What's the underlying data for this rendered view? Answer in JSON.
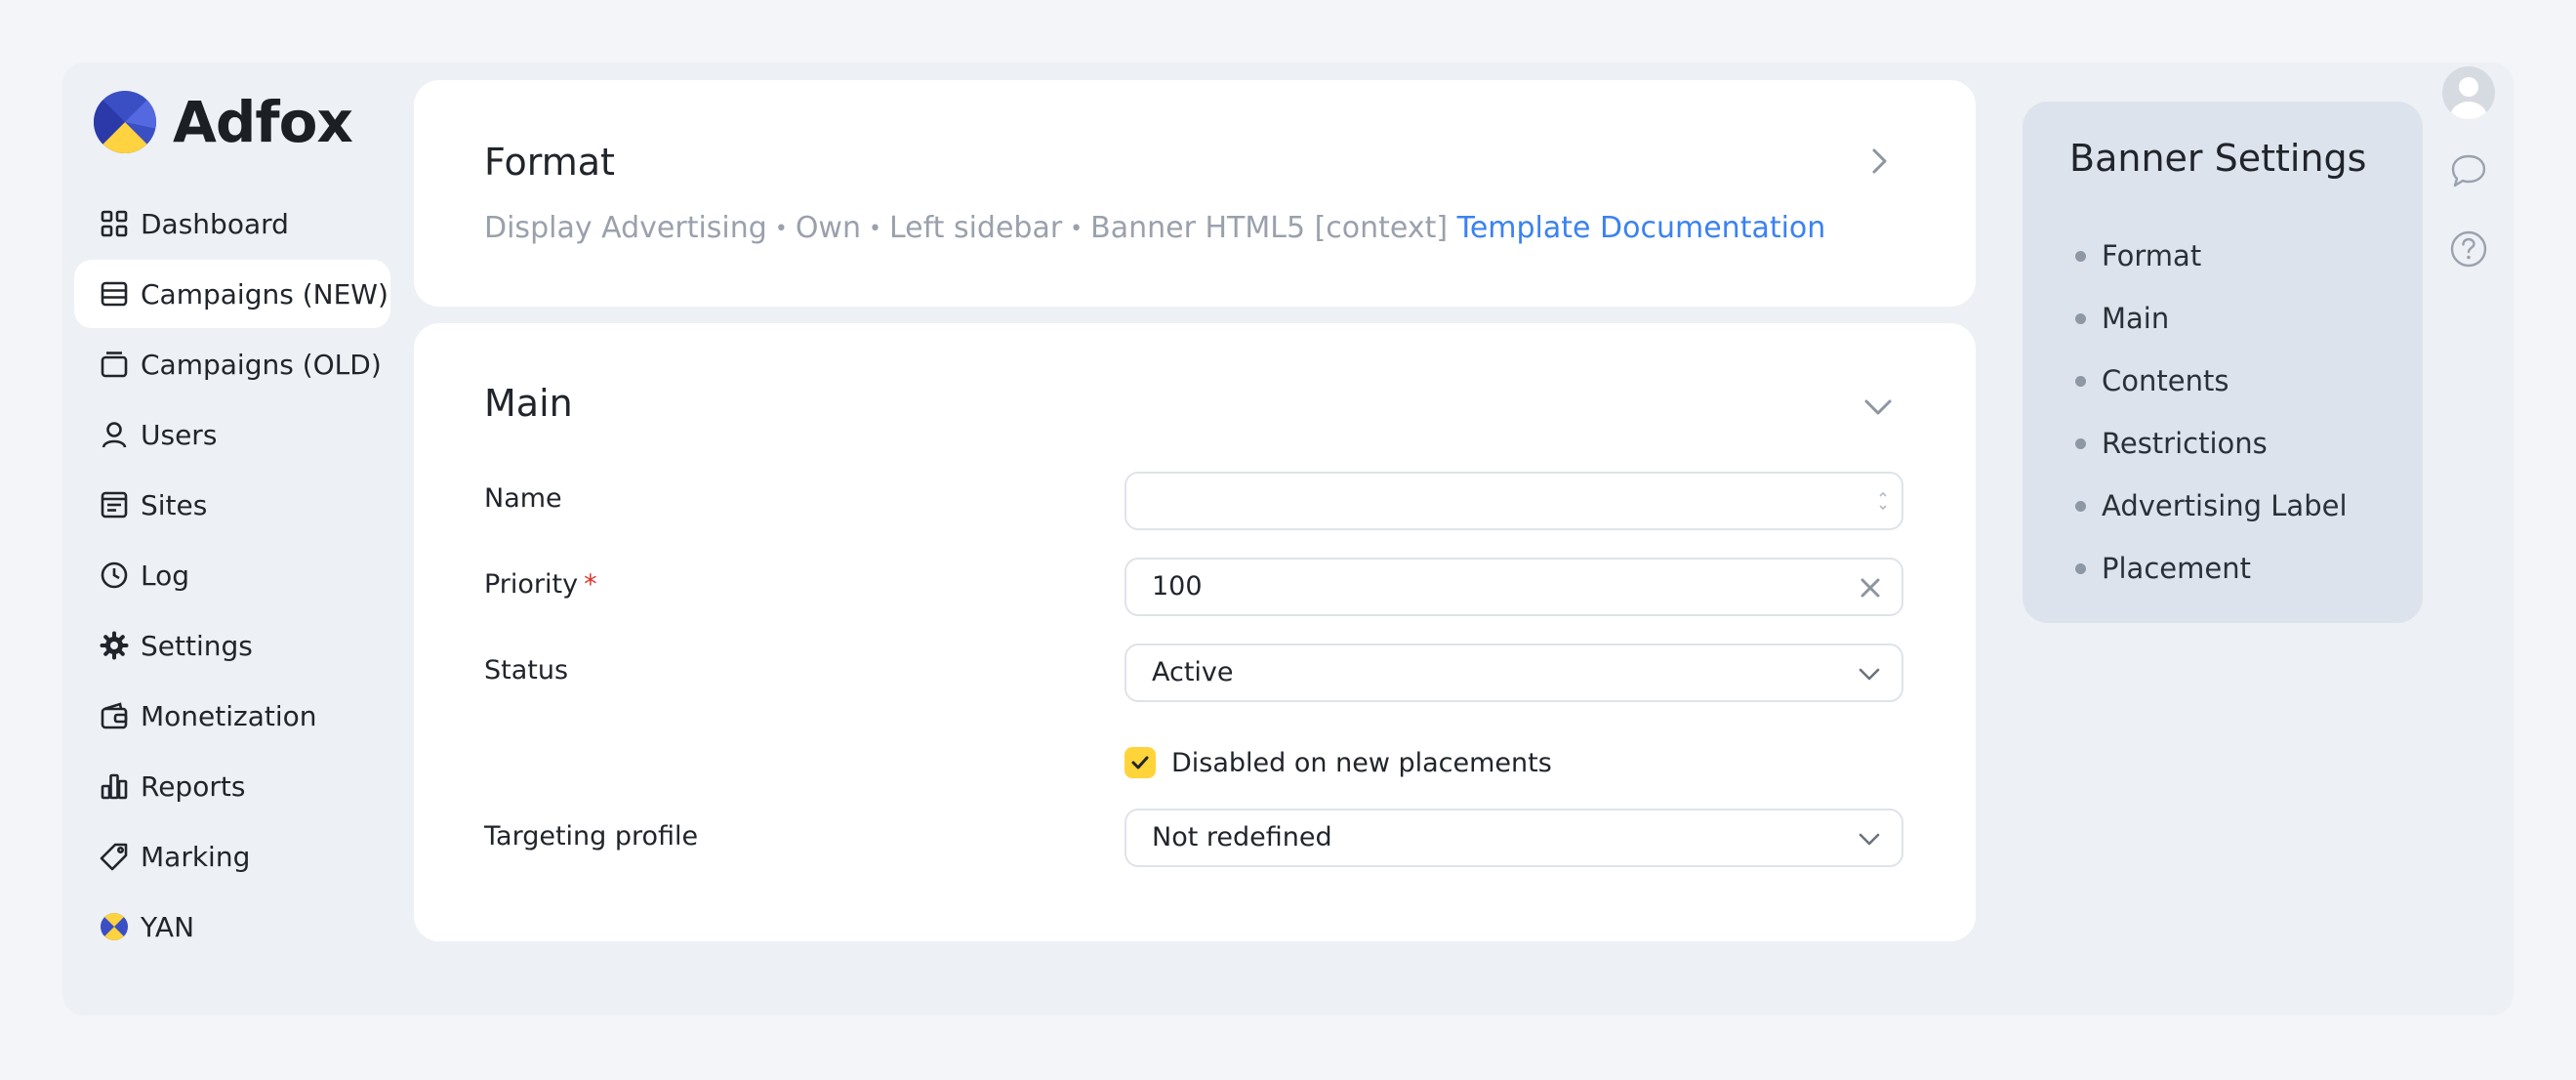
{
  "app": {
    "name": "Adfox"
  },
  "sidebar": {
    "items": [
      {
        "label": "Dashboard",
        "icon": "dashboard-icon",
        "active": false
      },
      {
        "label": "Campaigns (NEW)",
        "icon": "campaigns-icon",
        "active": true
      },
      {
        "label": "Campaigns (OLD)",
        "icon": "campaigns-old-icon",
        "active": false
      },
      {
        "label": "Users",
        "icon": "user-icon",
        "active": false
      },
      {
        "label": "Sites",
        "icon": "sites-icon",
        "active": false
      },
      {
        "label": "Log",
        "icon": "clock-icon",
        "active": false
      },
      {
        "label": "Settings",
        "icon": "gear-icon",
        "active": false
      },
      {
        "label": "Monetization",
        "icon": "wallet-icon",
        "active": false
      },
      {
        "label": "Reports",
        "icon": "bar-chart-icon",
        "active": false
      },
      {
        "label": "Marking",
        "icon": "tag-icon",
        "active": false
      },
      {
        "label": "YAN",
        "icon": "yan-logo-icon",
        "active": false
      }
    ]
  },
  "format_card": {
    "title": "Format",
    "breadcrumb": [
      "Display Advertising",
      "Own",
      "Left sidebar",
      "Banner HTML5 [context]"
    ],
    "separator": "•",
    "link_label": "Template Documentation"
  },
  "main_card": {
    "title": "Main",
    "fields": {
      "name": {
        "label": "Name",
        "value": ""
      },
      "priority": {
        "label": "Priority",
        "required_mark": "*",
        "value": "100"
      },
      "status": {
        "label": "Status",
        "value": "Active"
      },
      "disabled_on_new": {
        "label": "Disabled on new placements",
        "checked": true
      },
      "targeting": {
        "label": "Targeting profile",
        "value": "Not redefined"
      }
    }
  },
  "banner_settings": {
    "title": "Banner Settings",
    "items": [
      "Format",
      "Main",
      "Contents",
      "Restrictions",
      "Advertising Label",
      "Placement"
    ]
  },
  "colors": {
    "accent_link": "#3b82f0",
    "checkbox": "#ffd43b",
    "required": "#e0352b"
  }
}
